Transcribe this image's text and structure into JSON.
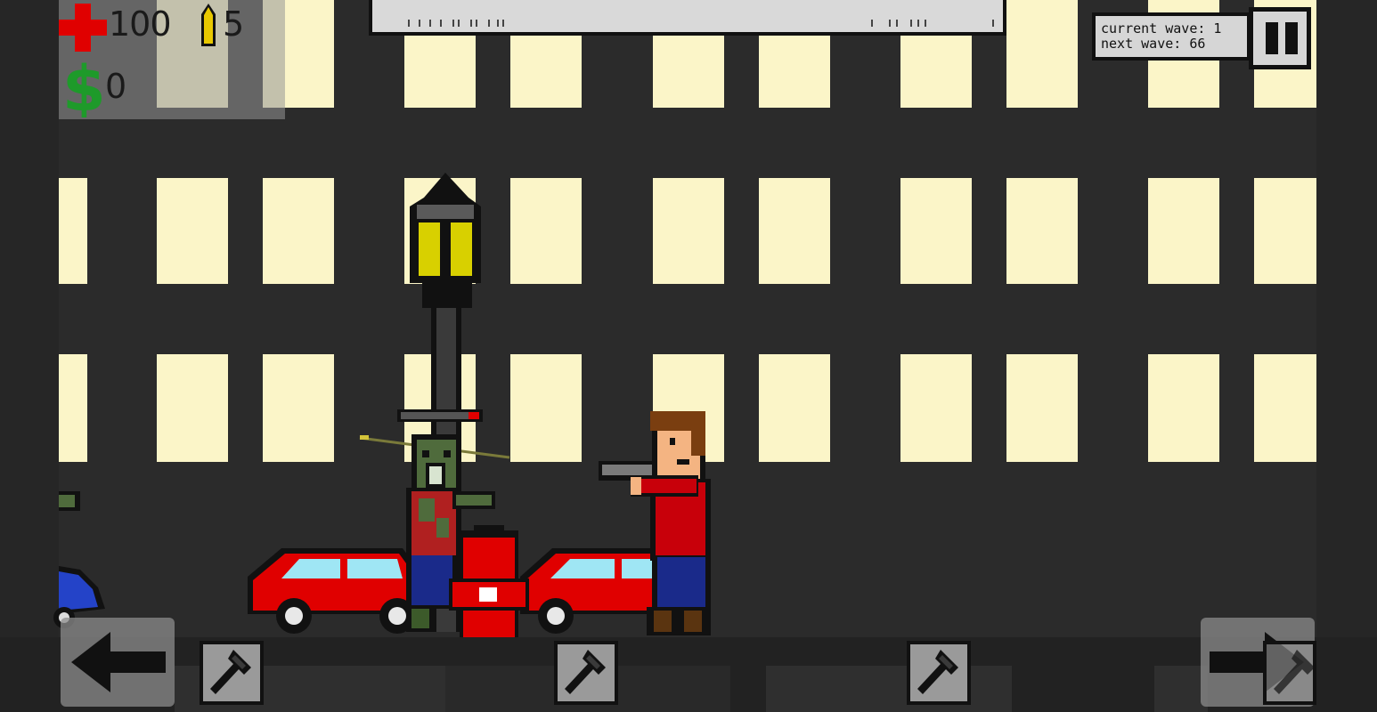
{
  "hud": {
    "health": "100",
    "ammo": "5",
    "money": "0"
  },
  "wave": {
    "current_label": "current wave: 1",
    "next_label": "next wave: 66"
  },
  "tool_slots": [
    {
      "tool": "hammer-icon"
    },
    {
      "tool": "hammer-icon"
    },
    {
      "tool": "hammer-icon"
    }
  ],
  "colors": {
    "window_light": "#fbf5c8",
    "building": "#2b2b2b",
    "car_red": "#e00000",
    "zombie_green": "#4f6b3c",
    "player_shirt": "#c8000a",
    "lamp_yellow": "#d8d000"
  }
}
